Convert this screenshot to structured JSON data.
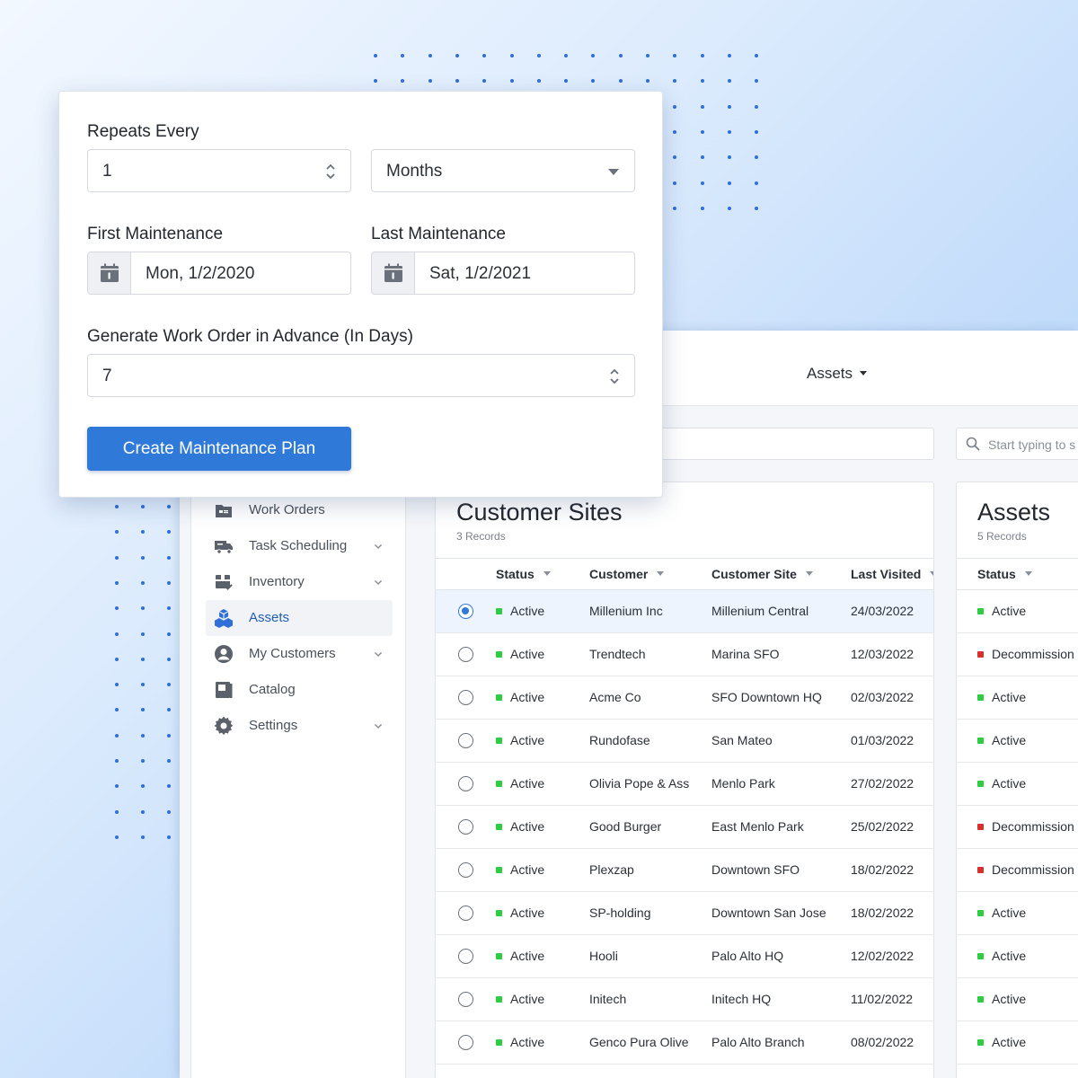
{
  "form": {
    "repeats_label": "Repeats Every",
    "repeats_value": "1",
    "unit_value": "Months",
    "first_label": "First Maintenance",
    "first_value": "Mon, 1/2/2020",
    "last_label": "Last Maintenance",
    "last_value": "Sat, 1/2/2021",
    "advance_label": "Generate Work Order in Advance (In Days)",
    "advance_value": "7",
    "create_button": "Create Maintenance Plan"
  },
  "topbar": {
    "assets_menu": "Assets"
  },
  "search": {
    "placeholder": "Start typing to s"
  },
  "sidebar": {
    "items": [
      {
        "label": "Work Orders",
        "icon": "work-orders-icon",
        "expandable": false,
        "active": false
      },
      {
        "label": "Task Scheduling",
        "icon": "truck-icon",
        "expandable": true,
        "active": false
      },
      {
        "label": "Inventory",
        "icon": "inventory-icon",
        "expandable": true,
        "active": false
      },
      {
        "label": "Assets",
        "icon": "cubes-icon",
        "expandable": false,
        "active": true
      },
      {
        "label": "My Customers",
        "icon": "user-circle-icon",
        "expandable": true,
        "active": false
      },
      {
        "label": "Catalog",
        "icon": "catalog-icon",
        "expandable": false,
        "active": false
      },
      {
        "label": "Settings",
        "icon": "gear-icon",
        "expandable": true,
        "active": false
      }
    ]
  },
  "sites": {
    "title": "Customer Sites",
    "count": "3 Records",
    "columns": [
      "Status",
      "Customer",
      "Customer Site",
      "Last Visited"
    ],
    "rows": [
      {
        "status": "Active",
        "customer": "Millenium Inc",
        "site": "Millenium Central",
        "last": "24/03/2022",
        "selected": true
      },
      {
        "status": "Active",
        "customer": "Trendtech",
        "site": "Marina SFO",
        "last": "12/03/2022",
        "selected": false
      },
      {
        "status": "Active",
        "customer": "Acme Co",
        "site": "SFO Downtown HQ",
        "last": "02/03/2022",
        "selected": false
      },
      {
        "status": "Active",
        "customer": "Rundofase",
        "site": "San Mateo",
        "last": "01/03/2022",
        "selected": false
      },
      {
        "status": "Active",
        "customer": "Olivia Pope & Ass",
        "site": "Menlo Park",
        "last": "27/02/2022",
        "selected": false
      },
      {
        "status": "Active",
        "customer": "Good Burger",
        "site": "East Menlo Park",
        "last": "25/02/2022",
        "selected": false
      },
      {
        "status": "Active",
        "customer": "Plexzap",
        "site": "Downtown SFO",
        "last": "18/02/2022",
        "selected": false
      },
      {
        "status": "Active",
        "customer": "SP-holding",
        "site": "Downtown San Jose",
        "last": "18/02/2022",
        "selected": false
      },
      {
        "status": "Active",
        "customer": "Hooli",
        "site": "Palo Alto HQ",
        "last": "12/02/2022",
        "selected": false
      },
      {
        "status": "Active",
        "customer": "Initech",
        "site": "Initech HQ",
        "last": "11/02/2022",
        "selected": false
      },
      {
        "status": "Active",
        "customer": "Genco Pura Olive",
        "site": "Palo Alto Branch",
        "last": "08/02/2022",
        "selected": false
      }
    ]
  },
  "assets": {
    "title": "Assets",
    "count": "5 Records",
    "column": "Status",
    "rows": [
      "Active",
      "Decommission",
      "Active",
      "Active",
      "Active",
      "Decommission",
      "Decommission",
      "Active",
      "Active",
      "Active",
      "Active"
    ]
  },
  "colors": {
    "primary": "#2f7ad8",
    "active": "#2ecc40",
    "decommissioned": "#d9302c"
  }
}
